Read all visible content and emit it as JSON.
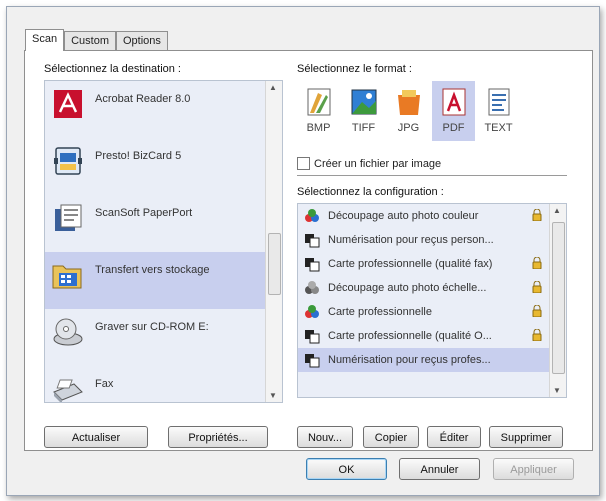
{
  "tabs": [
    "Scan",
    "Custom",
    "Options"
  ],
  "destination": {
    "title": "Sélectionnez la destination :",
    "items": [
      {
        "label": "Acrobat Reader 8.0",
        "icon": "acrobat-icon"
      },
      {
        "label": "Presto! BizCard 5",
        "icon": "bizcard-icon"
      },
      {
        "label": "ScanSoft PaperPort",
        "icon": "paperport-icon"
      },
      {
        "label": "Transfert vers stockage",
        "icon": "storage-icon",
        "selected": true
      },
      {
        "label": "Graver sur CD-ROM  E:",
        "icon": "cd-burn-icon"
      },
      {
        "label": "Fax",
        "icon": "fax-icon"
      }
    ],
    "refresh_label": "Actualiser",
    "properties_label": "Propriétés..."
  },
  "format": {
    "title": "Sélectionnez le format :",
    "items": [
      {
        "label": "BMP",
        "icon": "bmp-icon"
      },
      {
        "label": "TIFF",
        "icon": "tiff-icon"
      },
      {
        "label": "JPG",
        "icon": "jpg-icon"
      },
      {
        "label": "PDF",
        "icon": "pdf-icon",
        "selected": true
      },
      {
        "label": "TEXT",
        "icon": "text-icon"
      }
    ],
    "per_image_label": "Créer un fichier par image"
  },
  "configuration": {
    "title": "Sélectionnez la configuration :",
    "items": [
      {
        "label": "Découpage auto photo couleur",
        "locked": true
      },
      {
        "label": "Numérisation pour reçus person...",
        "locked": false
      },
      {
        "label": "Carte professionnelle (qualité fax)",
        "locked": true
      },
      {
        "label": "Découpage auto photo échelle...",
        "locked": true
      },
      {
        "label": "Carte professionnelle",
        "locked": true
      },
      {
        "label": "Carte professionnelle (qualité O...",
        "locked": true
      },
      {
        "label": "Numérisation pour reçus profes...",
        "locked": false,
        "selected": true
      }
    ],
    "new_label": "Nouv...",
    "copy_label": "Copier",
    "edit_label": "Éditer",
    "delete_label": "Supprimer"
  },
  "dialog": {
    "ok_label": "OK",
    "cancel_label": "Annuler",
    "apply_label": "Appliquer"
  },
  "colors": {
    "selection": "#c8cfee",
    "list_bg": "#eaeef7",
    "lock": "#e8b830"
  }
}
